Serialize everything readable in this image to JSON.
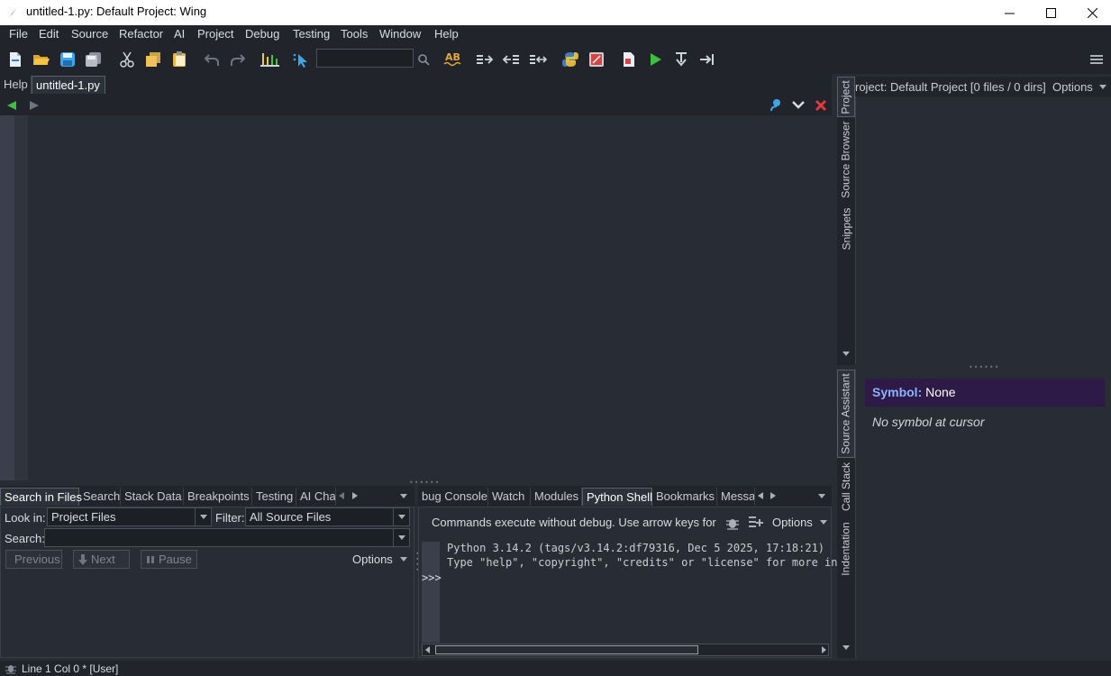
{
  "window": {
    "title": "untitled-1.py: Default Project: Wing"
  },
  "menubar": {
    "items": [
      "File",
      "Edit",
      "Source",
      "Refactor",
      "AI",
      "Project",
      "Debug",
      "Testing",
      "Tools",
      "Window",
      "Help"
    ]
  },
  "toolbar": {
    "search_value": "",
    "icons": [
      "new-file-icon",
      "open-folder-icon",
      "save-icon",
      "save-all-icon",
      "cut-icon",
      "copy-icon",
      "paste-icon",
      "undo-icon",
      "redo-icon",
      "indent-guides-icon",
      "select-pointer-icon",
      "search-icon",
      "spellcheck-icon",
      "indent-icon",
      "dedent-icon",
      "indent-toggle-icon",
      "python-icon",
      "stop-icon",
      "page-icon",
      "run-icon",
      "step-into-icon",
      "step-out-icon",
      "menu-icon"
    ],
    "spell_label": "AB"
  },
  "editor": {
    "tabs": [
      "Help",
      "untitled-1.py"
    ],
    "active_tab": "untitled-1.py"
  },
  "right_top": {
    "vtabs": [
      "Project",
      "Source Browser",
      "Snippets"
    ],
    "project_header": "roject: Default Project [0 files / 0 dirs]",
    "options_label": "Options"
  },
  "right_bottom": {
    "vtabs": [
      "Source Assistant",
      "Call Stack",
      "Indentation"
    ],
    "symbol_label": "Symbol:",
    "symbol_value": "None",
    "message": "No symbol at cursor"
  },
  "bottom_left": {
    "tabs": [
      "Search in Files",
      "Search",
      "Stack Data",
      "Breakpoints",
      "Testing",
      "AI Cha"
    ],
    "active_tab": "Search in Files",
    "look_in_label": "Look in:",
    "look_in_value": "Project Files",
    "filter_label": "Filter:",
    "filter_value": "All Source Files",
    "search_label": "Search:",
    "search_value": "",
    "previous_label": "Previous",
    "next_label": "Next",
    "pause_label": "Pause",
    "options_label": "Options"
  },
  "bottom_right": {
    "tabs": [
      "bug Console",
      "Watch",
      "Modules",
      "Python Shell",
      "Bookmarks",
      "Messa"
    ],
    "active_tab": "Python Shell",
    "info": "Commands execute without debug.  Use arrow keys for",
    "options_label": "Options",
    "prompt": ">>>",
    "lines": [
      "Python 3.14.2 (tags/v3.14.2:df79316, Dec  5 2025, 17:18:21)",
      "Type \"help\", \"copyright\", \"credits\" or \"license\" for more in"
    ]
  },
  "statusbar": {
    "text": "Line 1 Col 0 * [User]"
  },
  "colors": {
    "background": "#282c34",
    "chrome": "#21252b",
    "symbol_bg": "#2e1a47",
    "symbol_label": "#8ab4ff",
    "close_red": "#e0393e",
    "run_green": "#3fbf3f"
  }
}
